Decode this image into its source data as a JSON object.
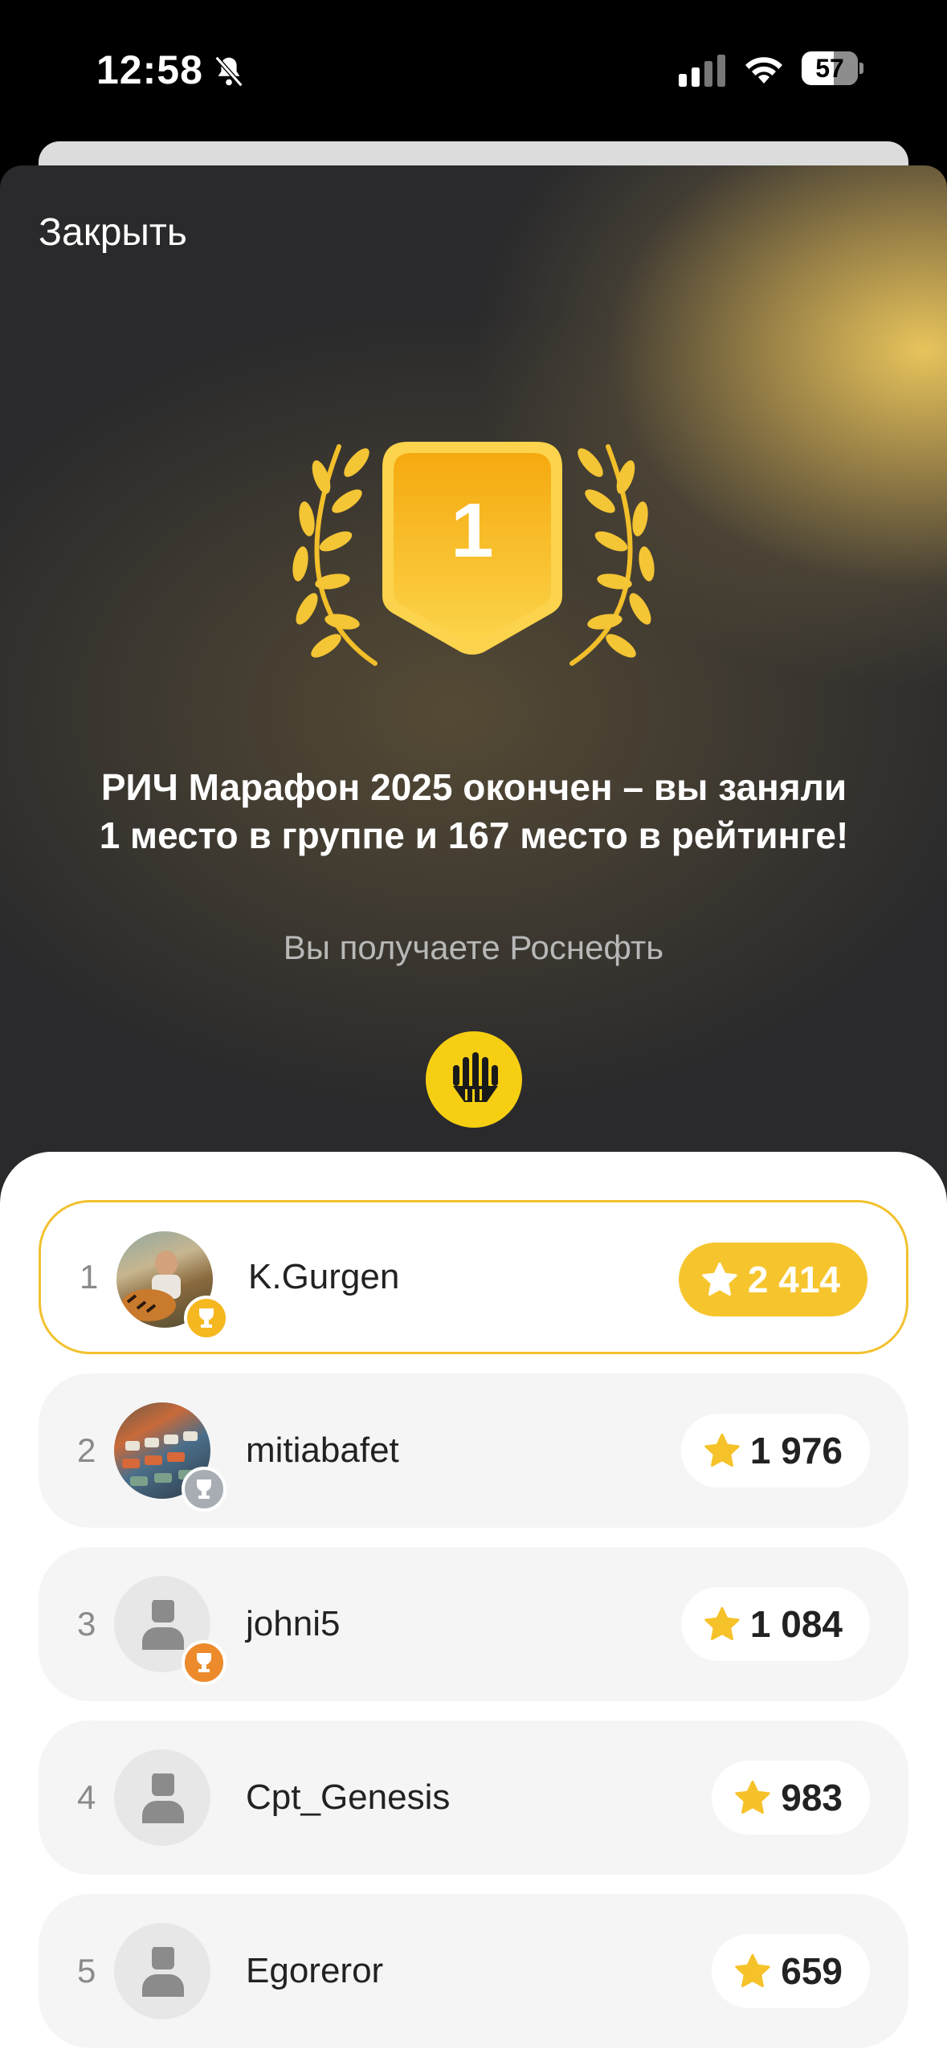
{
  "status_bar": {
    "time": "12:58",
    "battery": "57"
  },
  "header": {
    "close_label": "Закрыть"
  },
  "hero": {
    "place_number": "1",
    "headline": "РИЧ Марафон 2025 окончен – вы заняли 1 место в группе и 167 место в рейтинге!",
    "subline": "Вы получаете Роснефть",
    "reward_icon": "rosneft-logo-icon"
  },
  "colors": {
    "accent": "#F6C52E",
    "reward_bg": "#F6CF13",
    "dark_bg": "#2A2A2C"
  },
  "leaderboard": [
    {
      "rank": "1",
      "name": "K.Gurgen",
      "score": "2 414",
      "cup": "gold"
    },
    {
      "rank": "2",
      "name": "mitiabafet",
      "score": "1 976",
      "cup": "silver"
    },
    {
      "rank": "3",
      "name": "johni5",
      "score": "1 084",
      "cup": "bronze"
    },
    {
      "rank": "4",
      "name": "Cpt_Genesis",
      "score": "983"
    },
    {
      "rank": "5",
      "name": "Egoreror",
      "score": "659"
    }
  ]
}
